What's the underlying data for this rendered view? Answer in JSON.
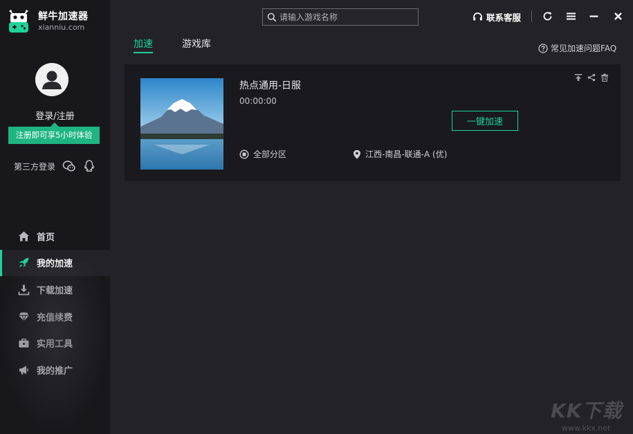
{
  "brand": {
    "name": "鲜牛加速器",
    "url": "xianniu.com"
  },
  "account": {
    "login_label": "登录/注册",
    "trial_badge": "注册即可享5小时体验",
    "third_party_label": "第三方登录"
  },
  "nav": {
    "items": [
      {
        "label": "首页",
        "icon": "home-icon",
        "active": false
      },
      {
        "label": "我的加速",
        "icon": "rocket-icon",
        "active": true
      },
      {
        "label": "下载加速",
        "icon": "download-icon",
        "active": false
      },
      {
        "label": "充值续费",
        "icon": "diamond-icon",
        "active": false
      },
      {
        "label": "实用工具",
        "icon": "toolbox-icon",
        "active": false
      },
      {
        "label": "我的推广",
        "icon": "megaphone-icon",
        "active": false
      }
    ]
  },
  "search": {
    "placeholder": "请输入游戏名称"
  },
  "header": {
    "support_label": "联系客服"
  },
  "tabs": [
    {
      "label": "加速",
      "active": true
    },
    {
      "label": "游戏库",
      "active": false
    }
  ],
  "faq_label": "常见加速问题FAQ",
  "game": {
    "name": "热点通用-日服",
    "timer": "00:00:00",
    "accelerate_label": "一键加速",
    "region": "全部分区",
    "server": "江西-南昌-联通-A (优)"
  },
  "watermark": {
    "text": "KK下载",
    "url": "www.kkx.net"
  },
  "colors": {
    "accent": "#1fd39b",
    "badge": "#1fb583",
    "sidebar_bg": "#18181b",
    "main_bg": "#232227",
    "card_bg": "#1a1a1e"
  }
}
